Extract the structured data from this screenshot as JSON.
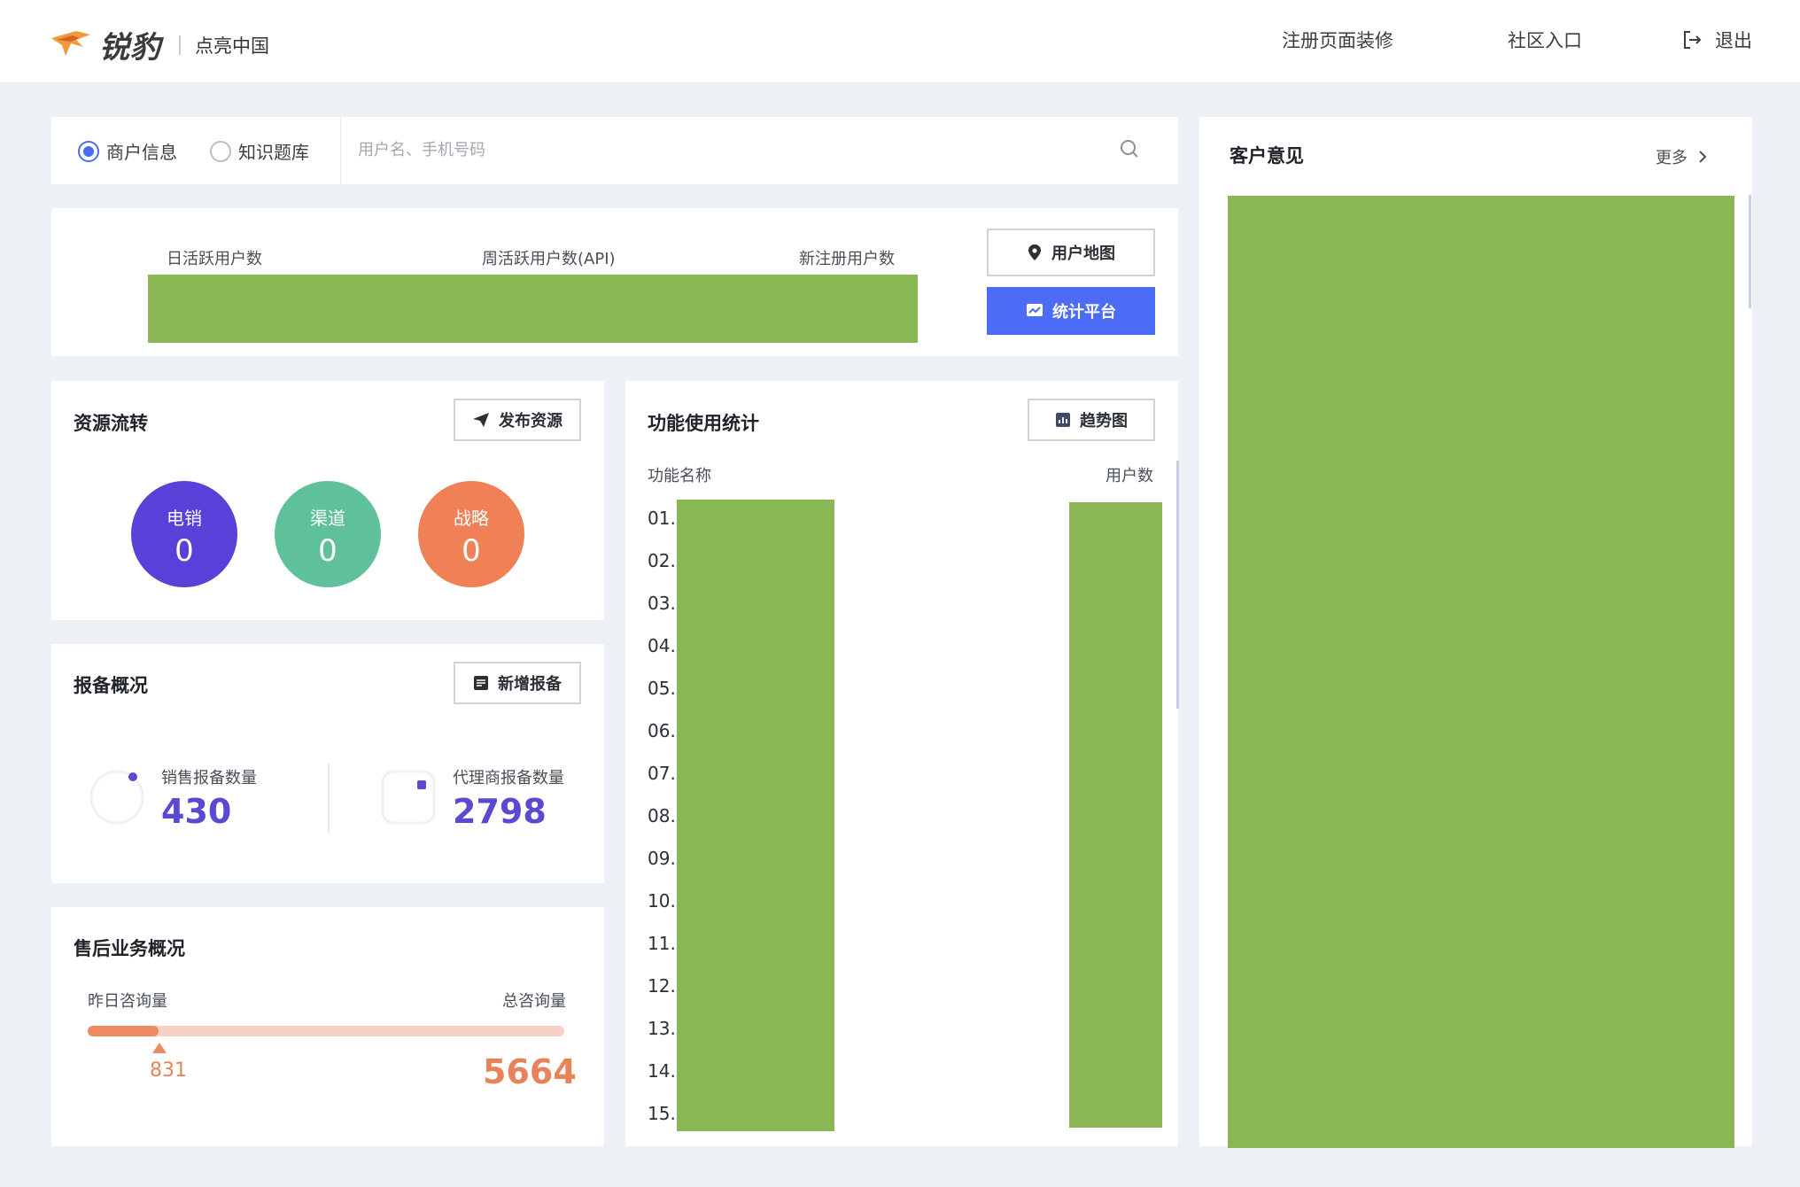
{
  "header": {
    "logo_text": "锐豹",
    "subtitle": "点亮中国",
    "nav": [
      "注册页面装修",
      "社区入口"
    ],
    "logout_label": "退出"
  },
  "search": {
    "options": [
      "商户信息",
      "知识题库"
    ],
    "selected": "商户信息",
    "placeholder": "用户名、手机号码"
  },
  "stats": {
    "labels": [
      "日活跃用户数",
      "周活跃用户数(API)",
      "新注册用户数"
    ],
    "map_button": "用户地图",
    "platform_button": "统计平台"
  },
  "resources": {
    "title": "资源流转",
    "button": "发布资源",
    "items": [
      {
        "label": "电销",
        "value": "0",
        "color": "#5a3fd8"
      },
      {
        "label": "渠道",
        "value": "0",
        "color": "#5fc199"
      },
      {
        "label": "战略",
        "value": "0",
        "color": "#f08156"
      }
    ]
  },
  "reports": {
    "title": "报备概况",
    "button": "新增报备",
    "sales_label": "销售报备数量",
    "sales_value": "430",
    "agent_label": "代理商报备数量",
    "agent_value": "2798"
  },
  "aftersales": {
    "title": "售后业务概况",
    "yesterday_label": "昨日咨询量",
    "total_label": "总咨询量",
    "yesterday_value": "831",
    "total_value": "5664"
  },
  "functions": {
    "title": "功能使用统计",
    "button": "趋势图",
    "col_name": "功能名称",
    "col_users": "用户数",
    "rows": [
      "01.",
      "02.",
      "03.",
      "04.",
      "05.",
      "06.",
      "07.",
      "08.",
      "09.",
      "10.",
      "11.",
      "12.",
      "13.",
      "14.",
      "15."
    ]
  },
  "feedback": {
    "title": "客户意见",
    "more": "更多"
  },
  "colors": {
    "accent": "#4a6cf7",
    "placeholder_block": "#88b754",
    "number_purple": "#5a4ad1",
    "number_orange": "#e8825a"
  }
}
